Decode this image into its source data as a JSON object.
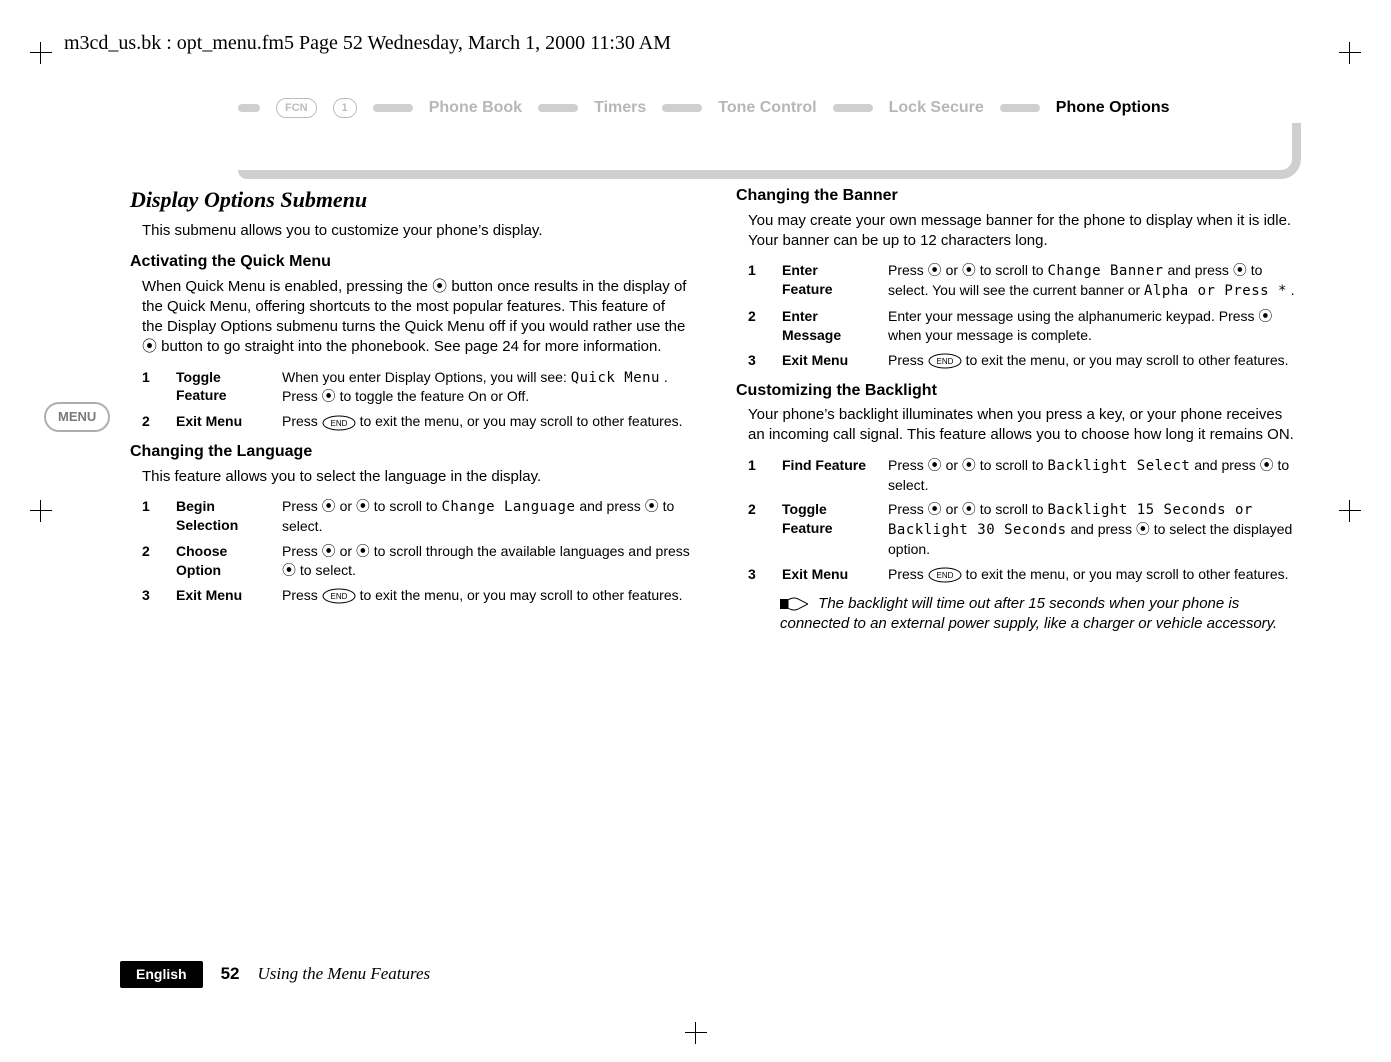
{
  "doc_header": "m3cd_us.bk : opt_menu.fm5  Page 52  Wednesday, March 1, 2000  11:30 AM",
  "nav": {
    "key_fcn": "FCN",
    "key_one": "1",
    "items": [
      "Phone Book",
      "Timers",
      "Tone Control",
      "Lock Secure",
      "Phone Options"
    ]
  },
  "menu_badge": "MENU",
  "left": {
    "title": "Display Options Submenu",
    "intro": "This submenu allows you to customize your phone’s display.",
    "s1": {
      "heading": "Activating the Quick Menu",
      "body": "When Quick Menu is enabled, pressing the ⦿ button once results in the display of the Quick Menu, offering shortcuts to the most popular features. This feature of the Display Options submenu turns the Quick Menu off if you would rather use the ⦿ button to go straight into the phonebook. See page 24 for more information.",
      "steps": [
        {
          "n": "1",
          "label": "Toggle Feature",
          "desc_pre": "When you enter Display Options, you will see: ",
          "code": "Quick Menu",
          "desc_post": ". Press ⦿ to toggle the feature On or Off."
        },
        {
          "n": "2",
          "label": "Exit Menu",
          "desc_pre": "Press ",
          "btn": "END",
          "desc_post": " to exit the menu, or you may scroll to other features."
        }
      ]
    },
    "s2": {
      "heading": "Changing the Language",
      "body": "This feature allows you to select the language in the display.",
      "steps": [
        {
          "n": "1",
          "label": "Begin Selection",
          "desc_pre": "Press ⦿ or ⦿ to scroll to ",
          "code": "Change Language",
          "desc_post": " and press ⦿ to select."
        },
        {
          "n": "2",
          "label": "Choose Option",
          "desc_pre": "Press ⦿ or ⦿ to scroll through the available languages and press ⦿ to select.",
          "code": "",
          "desc_post": ""
        },
        {
          "n": "3",
          "label": "Exit Menu",
          "desc_pre": "Press ",
          "btn": "END",
          "desc_post": " to exit the menu, or you may scroll to other features."
        }
      ]
    }
  },
  "right": {
    "s1": {
      "heading": "Changing the Banner",
      "body": "You may create your own message banner for the phone to display when it is idle. Your banner can be up to 12 characters long.",
      "steps": [
        {
          "n": "1",
          "label": "Enter Feature",
          "desc_pre": "Press ⦿ or ⦿ to scroll to ",
          "code": "Change Banner",
          "desc_post": " and press ⦿ to select. You will see the current banner or ",
          "code2": "Alpha or Press *",
          "tail": "."
        },
        {
          "n": "2",
          "label": "Enter Message",
          "desc_pre": "Enter your message using the alphanumeric keypad. Press ⦿ when your message is complete.",
          "code": "",
          "desc_post": ""
        },
        {
          "n": "3",
          "label": "Exit Menu",
          "desc_pre": "Press ",
          "btn": "END",
          "desc_post": " to exit the menu, or you may scroll to other features."
        }
      ]
    },
    "s2": {
      "heading": "Customizing the Backlight",
      "body": "Your phone’s backlight illuminates when you press a key, or your phone receives an incoming call signal. This feature allows you to choose how long it remains ON.",
      "steps": [
        {
          "n": "1",
          "label": "Find Feature",
          "desc_pre": "Press ⦿ or ⦿ to scroll to ",
          "code": "Backlight Select",
          "desc_post": " and press ⦿ to select."
        },
        {
          "n": "2",
          "label": "Toggle Feature",
          "desc_pre": "Press ⦿ or ⦿ to scroll to ",
          "code": "Backlight 15 Seconds or Backlight 30 Seconds",
          "desc_post": " and press ⦿ to select the displayed option."
        },
        {
          "n": "3",
          "label": "Exit Menu",
          "desc_pre": "Press ",
          "btn": "END",
          "desc_post": " to exit the menu, or you may scroll to other features."
        }
      ],
      "note": "The backlight will time out after 15 seconds when your phone is connected to an external power supply, like a charger or vehicle accessory."
    }
  },
  "footer": {
    "lang": "English",
    "page": "52",
    "title": "Using the Menu Features"
  }
}
